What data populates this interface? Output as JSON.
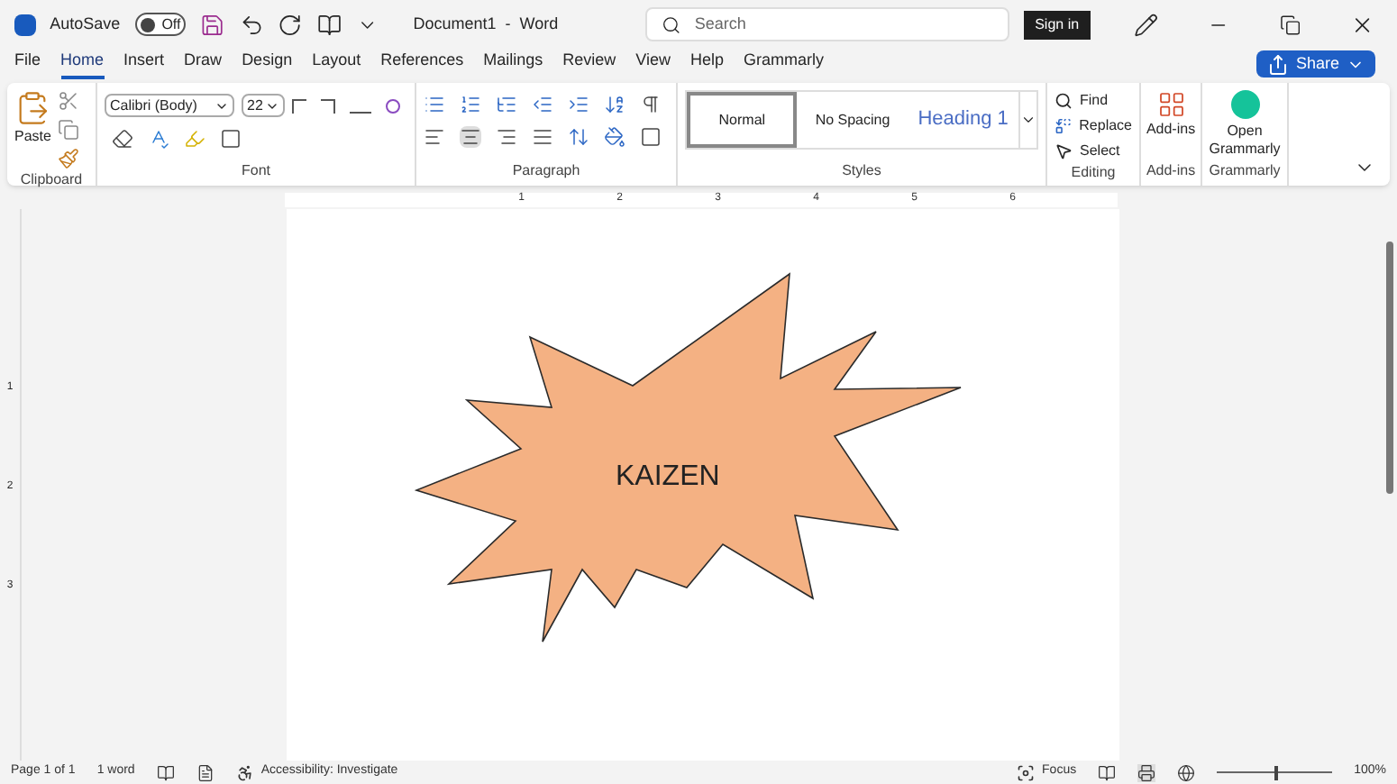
{
  "title_bar": {
    "autosave_label": "AutoSave",
    "autosave_toggle": {
      "label": "Off",
      "on": false
    },
    "document_title": "Document1  -  Word",
    "search": {
      "placeholder": "Search"
    },
    "sign_in": "Sign in"
  },
  "tabs": [
    {
      "label": "File",
      "selected": false
    },
    {
      "label": "Home",
      "selected": true
    },
    {
      "label": "Insert",
      "selected": false
    },
    {
      "label": "Draw",
      "selected": false
    },
    {
      "label": "Design",
      "selected": false
    },
    {
      "label": "Layout",
      "selected": false
    },
    {
      "label": "References",
      "selected": false
    },
    {
      "label": "Mailings",
      "selected": false
    },
    {
      "label": "Review",
      "selected": false
    },
    {
      "label": "View",
      "selected": false
    },
    {
      "label": "Help",
      "selected": false
    },
    {
      "label": "Grammarly",
      "selected": false
    }
  ],
  "share_button": "Share",
  "ribbon": {
    "clipboard": {
      "paste": "Paste",
      "label": "Clipboard"
    },
    "font": {
      "font_name": "Calibri (Body)",
      "font_size": "22",
      "label": "Font"
    },
    "paragraph": {
      "label": "Paragraph"
    },
    "styles": {
      "items": [
        {
          "label": "Normal",
          "selected": true
        },
        {
          "label": "No Spacing",
          "selected": false
        },
        {
          "label": "Heading 1",
          "selected": false
        }
      ],
      "label": "Styles"
    },
    "editing": {
      "find": "Find",
      "replace": "Replace",
      "select": "Select",
      "label": "Editing"
    },
    "add_ins": {
      "button": "Add-ins",
      "label": "Add-ins"
    },
    "grammarly": {
      "button_lines": [
        "Open",
        "Grammarly"
      ],
      "label": "Grammarly"
    }
  },
  "ruler": {
    "numbers": [
      "1",
      "2",
      "3",
      "4",
      "5",
      "6"
    ]
  },
  "vertical_ruler": {
    "numbers": [
      "1",
      "2",
      "3"
    ]
  },
  "document": {
    "shape_text": "KAIZEN"
  },
  "status_bar": {
    "page": "Page 1 of 1",
    "words": "1 word",
    "accessibility": "Accessibility: Investigate",
    "focus": "Focus",
    "zoom": {
      "reading": "100%",
      "level": 0.5
    }
  }
}
